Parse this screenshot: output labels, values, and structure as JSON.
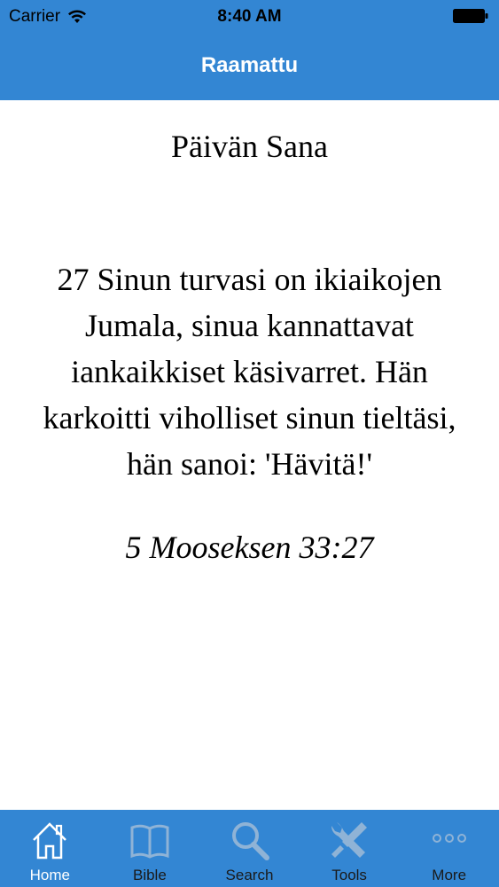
{
  "status_bar": {
    "carrier": "Carrier",
    "time": "8:40 AM",
    "wifi_icon": "wifi-icon",
    "battery_icon": "battery-icon"
  },
  "nav": {
    "title": "Raamattu"
  },
  "content": {
    "heading": "Päivän Sana",
    "verse": "27 Sinun turvasi on ikiaikojen Jumala, sinua kannattavat iankaikkiset käsivarret. Hän karkoitti viholliset sinun tieltäsi, hän sanoi: 'Hävitä!'",
    "reference": "5 Mooseksen 33:27",
    "share_icon": "share-icon"
  },
  "tabs": [
    {
      "label": "Home",
      "icon": "home-icon",
      "active": true
    },
    {
      "label": "Bible",
      "icon": "book-icon",
      "active": false
    },
    {
      "label": "Search",
      "icon": "search-icon",
      "active": false
    },
    {
      "label": "Tools",
      "icon": "tools-icon",
      "active": false
    },
    {
      "label": "More",
      "icon": "more-icon",
      "active": false
    }
  ],
  "colors": {
    "accent": "#3386d3",
    "tab_active_label": "#ffffff",
    "tab_inactive_icon": "#8fb3d6"
  }
}
